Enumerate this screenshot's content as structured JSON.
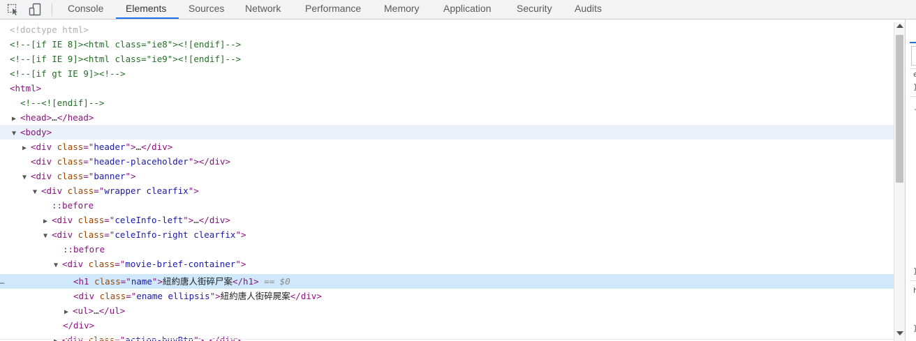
{
  "toolbar": {
    "tabs": [
      {
        "label": "Console"
      },
      {
        "label": "Elements",
        "active": true
      },
      {
        "label": "Sources"
      },
      {
        "label": "Network"
      },
      {
        "label": "Performance"
      },
      {
        "label": "Memory"
      },
      {
        "label": "Application"
      },
      {
        "label": "Security"
      },
      {
        "label": "Audits"
      }
    ],
    "icons": [
      "inspect-element-icon",
      "device-toggle-icon"
    ],
    "accent_color": "#1a73e8"
  },
  "tree": {
    "row01": "<!doctype html>",
    "row02": "<!--[if IE 8]><html class=\"ie8\"><![endif]-->",
    "row03": "<!--[if IE 9]><html class=\"ie9\"><![endif]-->",
    "row04": "<!--[if gt IE 9]><!-->",
    "row05": "<html>",
    "row06": "<!--<![endif]-->",
    "row07": {
      "open": "<head>",
      "ell": "…",
      "close": "</head>"
    },
    "row08": "<body>",
    "row09": {
      "tag": "<div ",
      "an": "class",
      "eq": "=\"",
      "av": "header",
      "gt": "\">",
      "ell": "…",
      "close": "</div>"
    },
    "row10": {
      "tag": "<div ",
      "an": "class",
      "eq": "=\"",
      "av": "header-placeholder",
      "gt": "\">",
      "close": "</div>"
    },
    "row11": {
      "tag": "<div ",
      "an": "class",
      "eq": "=\"",
      "av": "banner",
      "gt": "\">"
    },
    "row12": {
      "tag": "<div ",
      "an": "class",
      "eq": "=\"",
      "av": "wrapper clearfix",
      "gt": "\">"
    },
    "row13": "::before",
    "row14": {
      "tag": "<div ",
      "an": "class",
      "eq": "=\"",
      "av": "celeInfo-left",
      "gt": "\">",
      "ell": "…",
      "close": "</div>"
    },
    "row15": {
      "tag": "<div ",
      "an": "class",
      "eq": "=\"",
      "av": "celeInfo-right clearfix",
      "gt": "\">"
    },
    "row16": "::before",
    "row17": {
      "tag": "<div ",
      "an": "class",
      "eq": "=\"",
      "av": "movie-brief-container",
      "gt": "\">"
    },
    "row18": {
      "tag": "<h1 ",
      "an": "class",
      "eq": "=\"",
      "av": "name",
      "gt": "\">",
      "text": "紐約唐人街碎尸案",
      "close": "</h1>",
      "dollar": " == $0"
    },
    "row19": {
      "tag": "<div ",
      "an": "class",
      "eq": "=\"",
      "av": "ename ellipsis",
      "gt": "\">",
      "text": "紐約唐人街碎屍案",
      "close": "</div>"
    },
    "row20": {
      "open": "<ul>",
      "ell": "…",
      "close": "</ul>"
    },
    "row21": "</div>",
    "row22": {
      "tag": "<div ",
      "an": "class",
      "eq": "=\"",
      "av": "action-buyBtn",
      "gt": "\">",
      "ell": "…",
      "close": "</div>"
    },
    "selected_dots": "…"
  },
  "sidepane": {
    "chars": [
      "e",
      "}",
      "-",
      "}",
      "h",
      "}"
    ]
  }
}
